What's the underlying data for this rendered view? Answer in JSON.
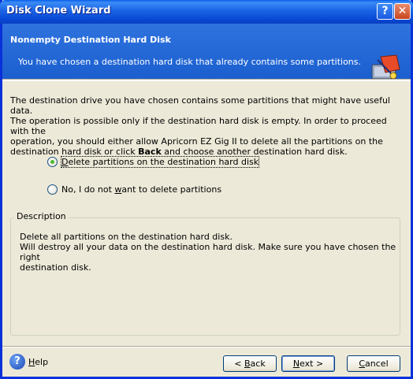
{
  "window": {
    "title": "Disk Clone Wizard",
    "help_glyph": "?",
    "close_glyph": "✕"
  },
  "header": {
    "title": "Nonempty Destination Hard Disk",
    "subtitle": "You have chosen a destination hard disk that already contains some partitions."
  },
  "body": {
    "line1": "The destination drive you have chosen contains some partitions that might have useful data.",
    "line2": "The operation is possible only if the destination hard disk is empty. In order to proceed with the",
    "line3": "operation, you should either allow Apricorn EZ Gig II to delete all the partitions on the",
    "line4_pre": "destination hard disk or click ",
    "line4_bold": "Back",
    "line4_post": " and choose another destination hard disk."
  },
  "options": [
    {
      "label_first": "D",
      "label_rest": "elete partitions on the destination hard disk",
      "checked": true
    },
    {
      "label_pre": "No, I do not ",
      "label_u": "w",
      "label_post": "ant to delete partitions",
      "checked": false
    }
  ],
  "description": {
    "legend": "Description",
    "line1": "Delete all partitions on the destination hard disk.",
    "line2": "Will destroy all your data on the destination hard disk. Make sure you have chosen the right",
    "line3": "destination disk."
  },
  "footer": {
    "help_u": "H",
    "help_rest": "elp",
    "back_pre": "< ",
    "back_u": "B",
    "back_post": "ack",
    "next_u": "N",
    "next_post": "ext >",
    "cancel_u": "C",
    "cancel_post": "ancel"
  }
}
